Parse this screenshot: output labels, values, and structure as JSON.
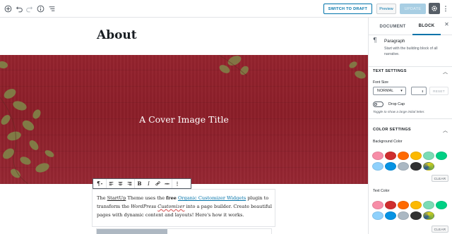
{
  "toolbar": {
    "switch_to_draft": "SWITCH TO DRAFT",
    "preview": "Preview",
    "update": "UPDATE"
  },
  "editor": {
    "title": "About",
    "cover_title": "A Cover Image Title",
    "paragraph": {
      "t1": "The ",
      "startup": "StartUp",
      "t2": " Theme uses the ",
      "free": "free",
      "t3": " ",
      "link": "Organic Customizer Widgets",
      "t4": " plugin to transform the ",
      "wordpress": "WordPress",
      "t5": " ",
      "customizer": "Customizer",
      "t6": " into a page builder. Create beautiful pages with dynamic content and layouts! Here's how it works."
    }
  },
  "sidebar": {
    "tab_document": "DOCUMENT",
    "tab_block": "BLOCK",
    "block_name": "Paragraph",
    "block_desc": "Start with the building block of all narrative.",
    "text_settings": {
      "title": "TEXT SETTINGS",
      "font_size_label": "Font Size",
      "font_size_value": "NORMAL",
      "reset_label": "RESET",
      "drop_cap_label": "Drop Cap",
      "drop_cap_help": "Toggle to show a large initial letter."
    },
    "color_settings": {
      "title": "COLOR SETTINGS",
      "background_label": "Background Color",
      "text_label": "Text Color",
      "clear_label": "CLEAR",
      "swatches": [
        "#f78da7",
        "#cf2e2e",
        "#ff6900",
        "#fcb900",
        "#7bdcb5",
        "#00d084",
        "#8ed1fc",
        "#0693e3",
        "#abb8c3",
        "#313131",
        "gradient"
      ]
    }
  },
  "colors": {
    "accent": "#0073aa",
    "cover": "#8c1f29"
  }
}
